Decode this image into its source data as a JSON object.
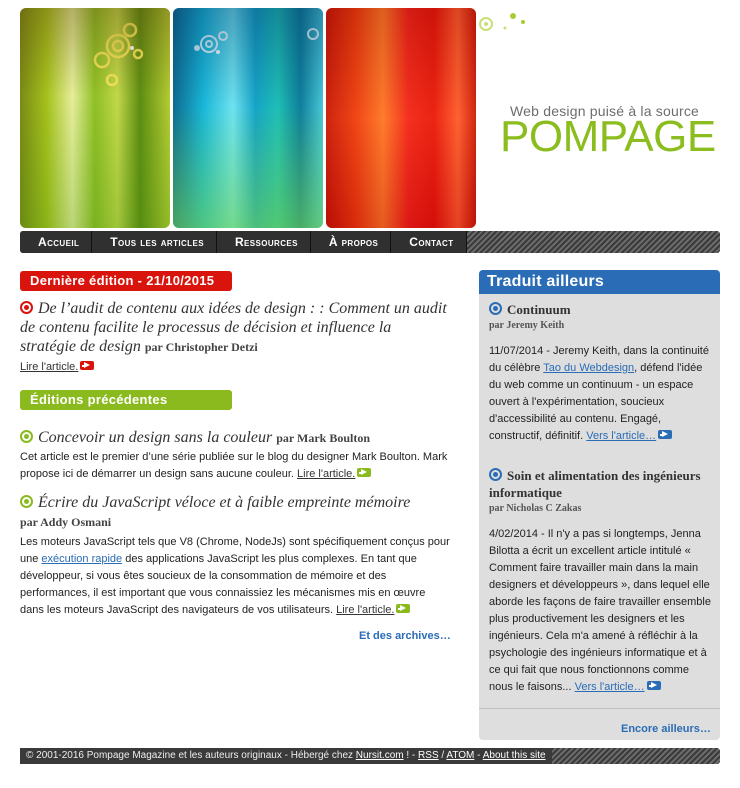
{
  "brand": {
    "tagline": "Web design puisé à la source",
    "name": "POMPAGE",
    "brand_color": "#8bbd1f"
  },
  "nav": {
    "items": [
      "Accueil",
      "Tous les articles",
      "Ressources",
      "À propos",
      "Contact"
    ]
  },
  "latest": {
    "tag": "Dernière édition - 21/10/2015",
    "title": "De l’audit de contenu aux idées de design : : Comment un audit de contenu facilite le processus de décision et influence la stratégie de design",
    "author": "par Christopher Detzi",
    "read_link": "Lire l'article."
  },
  "previous": {
    "tag": "Éditions précédentes",
    "articles": [
      {
        "title": "Concevoir un design sans la couleur",
        "author": "par Mark Boulton",
        "text": "Cet article est le premier d’une série publiée sur le blog du designer Mark Boulton. Mark propose ici de démarrer un design sans aucune couleur.",
        "read_link": "Lire l'article."
      },
      {
        "title": "Écrire du JavaScript véloce et à faible empreinte mémoire",
        "author": "par Addy Osmani",
        "text_before": "Les moteurs JavaScript tels que V8 (Chrome, NodeJs) sont spécifiquement conçus pour une",
        "inline_link": "exécution rapide",
        "text_after": "des applications JavaScript les plus complexes. En tant que développeur, si vous êtes soucieux de la consommation de mémoire et des performances, il est important que vous connaissiez les mécanismes mis en œuvre dans les moteurs JavaScript des navigateurs de vos utilisateurs.",
        "read_link": "Lire l'article."
      }
    ],
    "archives_link": "Et des archives…"
  },
  "sidebar": {
    "heading": "Traduit ailleurs",
    "items": [
      {
        "title": "Continuum",
        "author": "par Jeremy Keith",
        "text_before": "11/07/2014 - Jeremy Keith, dans la continuité du célèbre",
        "inline_link": "Tao du Webdesign",
        "text_after": ", défend l'idée du web comme un continuum - un espace ouvert à l'expérimentation, soucieux d'accessibilité au contenu. Engagé, constructif, définitif.",
        "more_link": "Vers l'article…"
      },
      {
        "title": "Soin et alimentation des ingénieurs informatique",
        "author": "par Nicholas C Zakas",
        "text": "4/02/2014 - Il n'y a pas si longtemps, Jenna Bilotta a écrit un excellent article intitulé « Comment faire travailler main dans la main designers et développeurs », dans lequel elle aborde les façons de faire travailler ensemble plus productivement les designers et les ingénieurs. Cela m'a amené à réfléchir à la psychologie des ingénieurs informatique et à ce qui fait que nous fonctionnons comme nous le faisons...",
        "more_link": "Vers l'article…"
      }
    ],
    "more_link": "Encore ailleurs…"
  },
  "footer": {
    "text_before": "© 2001-2016 Pompage Magazine et les auteurs originaux - Hébergé chez",
    "host_link": "Nursit.com",
    "sep1": "! -",
    "rss_link": "RSS",
    "sep2": "/",
    "atom_link": "ATOM",
    "sep3": "-",
    "about_link": "About this site"
  },
  "colors": {
    "red": "#d8140d",
    "green": "#8aba1e",
    "blue": "#2a6cb5"
  }
}
